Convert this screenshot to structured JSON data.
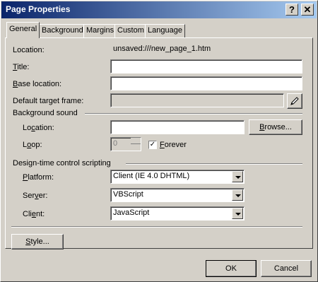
{
  "window": {
    "title": "Page Properties",
    "help_label": "?",
    "close_label": "✕"
  },
  "tabs": [
    {
      "label": "General"
    },
    {
      "label": "Background"
    },
    {
      "label": "Margins"
    },
    {
      "label": "Custom"
    },
    {
      "label": "Language"
    }
  ],
  "general": {
    "location_label": "Location:",
    "location_value": "unsaved:///new_page_1.htm",
    "title_label_u": "T",
    "title_label_rest": "itle:",
    "title_value": "",
    "base_label_u": "B",
    "base_label_rest": "ase location:",
    "base_value": "",
    "target_label_rest": "Default target frame:",
    "target_value": "",
    "target_button_icon": "pencil-icon"
  },
  "background_sound": {
    "group_label": "Background sound",
    "location_label_pre": "Lo",
    "location_label_u": "c",
    "location_label_rest": "ation:",
    "location_value": "",
    "browse_label_u": "B",
    "browse_label_rest": "rowse...",
    "loop_label_pre": "L",
    "loop_label_u": "o",
    "loop_label_rest": "op:",
    "loop_value": "0",
    "forever_checked": true,
    "forever_label_u": "F",
    "forever_label_rest": "orever"
  },
  "scripting": {
    "group_label": "Design-time control scripting",
    "platform_label_u": "P",
    "platform_label_rest": "latform:",
    "platform_value": "Client (IE 4.0 DHTML)",
    "server_label_pre": "Ser",
    "server_label_u": "v",
    "server_label_rest": "er:",
    "server_value": "VBScript",
    "client_label_pre": "Cli",
    "client_label_u": "e",
    "client_label_rest": "nt:",
    "client_value": "JavaScript"
  },
  "style_button": {
    "label_u": "S",
    "label_rest": "tyle..."
  },
  "footer": {
    "ok_label": "OK",
    "cancel_label": "Cancel"
  }
}
